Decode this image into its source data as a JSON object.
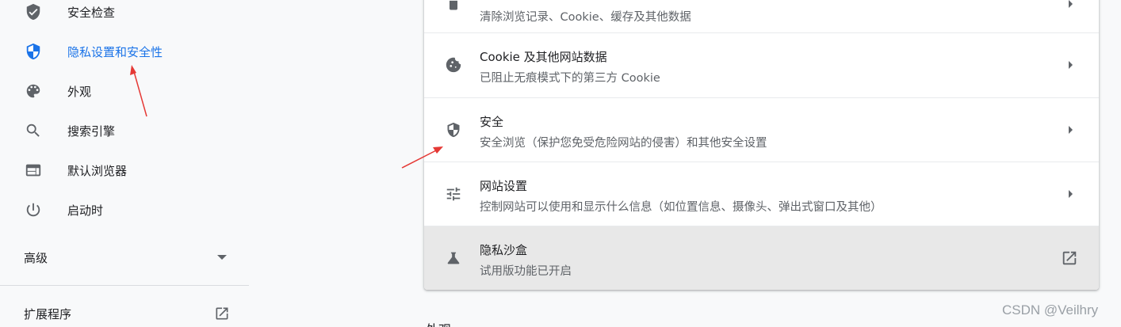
{
  "sidebar": {
    "items": [
      {
        "label": "安全检查",
        "icon": "shield-check-icon"
      },
      {
        "label": "隐私设置和安全性",
        "icon": "shield-privacy-icon",
        "active": true
      },
      {
        "label": "外观",
        "icon": "palette-icon"
      },
      {
        "label": "搜索引擎",
        "icon": "search-icon"
      },
      {
        "label": "默认浏览器",
        "icon": "browser-window-icon"
      },
      {
        "label": "启动时",
        "icon": "power-icon"
      }
    ],
    "advanced_label": "高级",
    "extensions_label": "扩展程序"
  },
  "privacy_card": {
    "rows": [
      {
        "title": "",
        "subtitle": "清除浏览记录、Cookie、缓存及其他数据",
        "icon": "trash-icon"
      },
      {
        "title": "Cookie 及其他网站数据",
        "subtitle": "已阻止无痕模式下的第三方 Cookie",
        "icon": "cookie-icon"
      },
      {
        "title": "安全",
        "subtitle": "安全浏览（保护您免受危险网站的侵害）和其他安全设置",
        "icon": "security-shield-icon"
      },
      {
        "title": "网站设置",
        "subtitle": "控制网站可以使用和显示什么信息（如位置信息、摄像头、弹出式窗口及其他）",
        "icon": "tune-sliders-icon"
      },
      {
        "title": "隐私沙盒",
        "subtitle": "试用版功能已开启",
        "icon": "flask-icon"
      }
    ]
  },
  "next_section_peek": "外观",
  "watermark": "CSDN @Veilhry",
  "colors": {
    "accent": "#1a73e8",
    "icon": "#5f6368",
    "annotation": "#e53935"
  }
}
